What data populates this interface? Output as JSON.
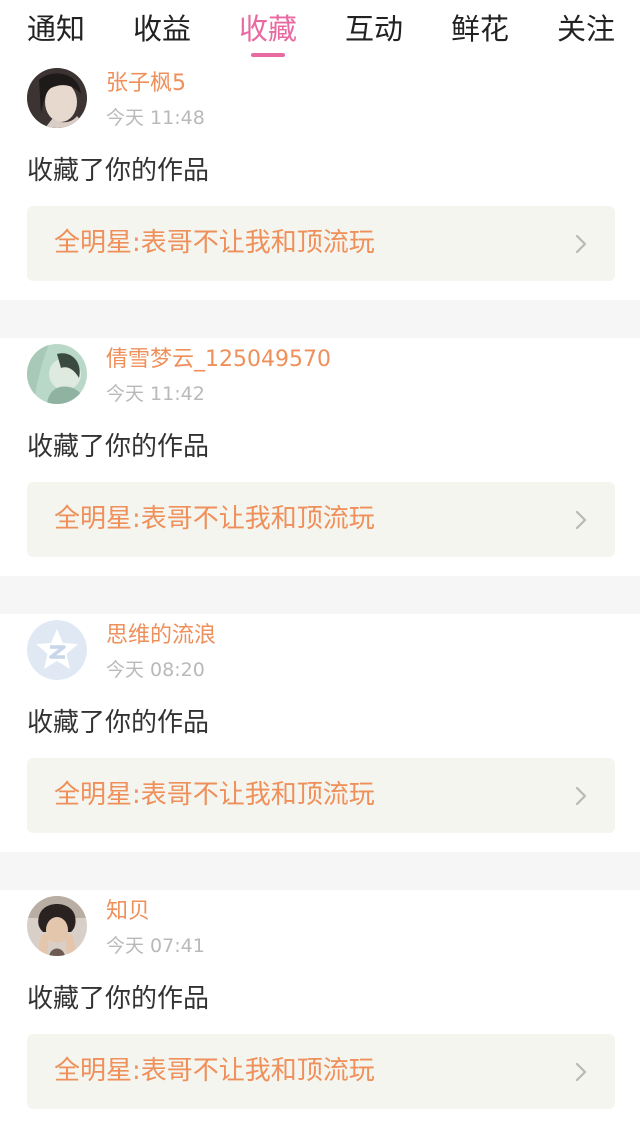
{
  "tabs": [
    {
      "label": "通知"
    },
    {
      "label": "收益"
    },
    {
      "label": "收藏"
    },
    {
      "label": "互动"
    },
    {
      "label": "鲜花"
    },
    {
      "label": "关注"
    }
  ],
  "active_tab": "收藏",
  "colors": {
    "accent": "#e86aa1",
    "username": "#ef8f5a",
    "work_title": "#ef8f5a",
    "time": "#b9b9b9",
    "card_bg": "#f5f5ef",
    "separator": "#f6f6f6"
  },
  "notifications": [
    {
      "username": "张子枫5",
      "time": "今天 11:48",
      "action": "收藏了你的作品",
      "work_title": "全明星:表哥不让我和顶流玩",
      "avatar_icon": "user-photo-avatar"
    },
    {
      "username": "倩雪梦云_125049570",
      "time": "今天 11:42",
      "action": "收藏了你的作品",
      "work_title": "全明星:表哥不让我和顶流玩",
      "avatar_icon": "user-photo-avatar"
    },
    {
      "username": "思维的流浪",
      "time": "今天 08:20",
      "action": "收藏了你的作品",
      "work_title": "全明星:表哥不让我和顶流玩",
      "avatar_icon": "default-star-avatar"
    },
    {
      "username": "知贝",
      "time": "今天 07:41",
      "action": "收藏了你的作品",
      "work_title": "全明星:表哥不让我和顶流玩",
      "avatar_icon": "user-photo-avatar"
    }
  ]
}
